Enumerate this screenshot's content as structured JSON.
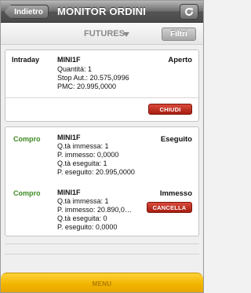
{
  "header": {
    "back_label": "Indietro",
    "title": "MONITOR ORDINI",
    "refresh_icon": "refresh-icon"
  },
  "filterbar": {
    "market_label": "FUTURES",
    "filter_label": "Filtri"
  },
  "orders": [
    {
      "type": "Intraday",
      "instrument": "MINI1F",
      "details": [
        "Quantità: 1",
        "Stop Aut.: 20.575,0996",
        "PMC: 20.995,0000"
      ],
      "status": "Aperto",
      "action": "CHIUDI"
    },
    {
      "type": "Compro",
      "instrument": "MINI1F",
      "details": [
        "Q.tà immessa: 1",
        "P. immesso: 0,0000",
        "Q.tà eseguita: 1",
        "P. eseguito: 20.995,0000"
      ],
      "status": "Eseguito"
    },
    {
      "type": "Compro",
      "instrument": "MINI1F",
      "details": [
        "Q.tà immessa: 1",
        "P. immesso: 20.890,0…",
        "Q.tà eseguita: 0",
        "P. eseguito: 0,0000"
      ],
      "status": "Immesso",
      "action": "CANCELLA"
    }
  ],
  "menu": {
    "label": "MENU"
  },
  "colors": {
    "buy_green": "#3e8a22",
    "action_red": "#b8271a",
    "menu_yellow": "#f2b500"
  }
}
